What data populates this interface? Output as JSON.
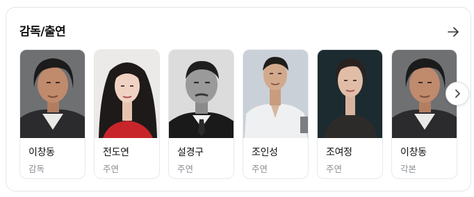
{
  "section": {
    "title": "감독/출연"
  },
  "icons": {
    "more": "arrow-right-icon",
    "next": "chevron-right-icon"
  },
  "people": [
    {
      "name": "이창동",
      "role": "감독"
    },
    {
      "name": "전도연",
      "role": "주연"
    },
    {
      "name": "설경구",
      "role": "주연"
    },
    {
      "name": "조인성",
      "role": "주연"
    },
    {
      "name": "조여정",
      "role": "주연"
    },
    {
      "name": "이창동",
      "role": "각본"
    }
  ],
  "colors": {
    "title": "#111111",
    "role": "#8a8f95",
    "border": "#e3e5e8"
  }
}
